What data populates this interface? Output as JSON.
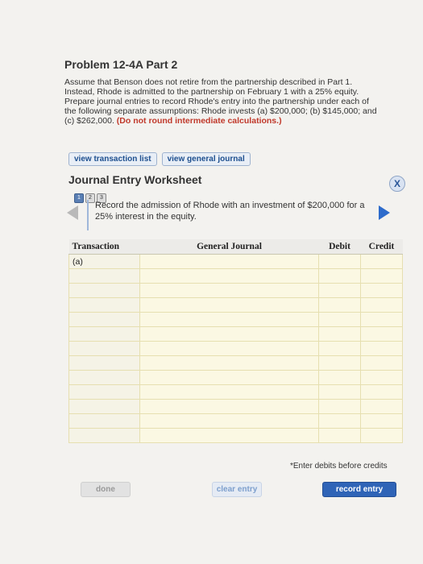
{
  "problem": {
    "title": "Problem 12-4A Part 2",
    "intro_text": "Assume that Benson does not retire from the partnership described in Part 1. Instead, Rhode is admitted to the partnership on February 1 with a 25% equity. Prepare journal entries to record Rhode's entry into the partnership under each of the following separate assumptions: Rhode invests (a) $200,000; (b) $145,000; and (c) $262,000.",
    "intro_note": "(Do not round intermediate calculations.)"
  },
  "tabs": {
    "transaction_list": "view transaction list",
    "general_journal": "view general journal"
  },
  "worksheet": {
    "title": "Journal Entry Worksheet",
    "close_label": "X",
    "pages": [
      "1",
      "2",
      "3"
    ],
    "prompt": "Record the admission of Rhode with an investment of $200,000 for a 25% interest in the equity.",
    "columns": {
      "transaction": "Transaction",
      "general_journal": "General Journal",
      "debit": "Debit",
      "credit": "Credit"
    },
    "rows": [
      {
        "transaction": "(a)"
      },
      {
        "transaction": ""
      },
      {
        "transaction": ""
      },
      {
        "transaction": ""
      },
      {
        "transaction": ""
      },
      {
        "transaction": ""
      },
      {
        "transaction": ""
      },
      {
        "transaction": ""
      },
      {
        "transaction": ""
      },
      {
        "transaction": ""
      },
      {
        "transaction": ""
      },
      {
        "transaction": ""
      },
      {
        "transaction": ""
      }
    ],
    "hint": "*Enter debits before credits"
  },
  "buttons": {
    "done": "done",
    "clear_entry": "clear entry",
    "record_entry": "record entry"
  }
}
